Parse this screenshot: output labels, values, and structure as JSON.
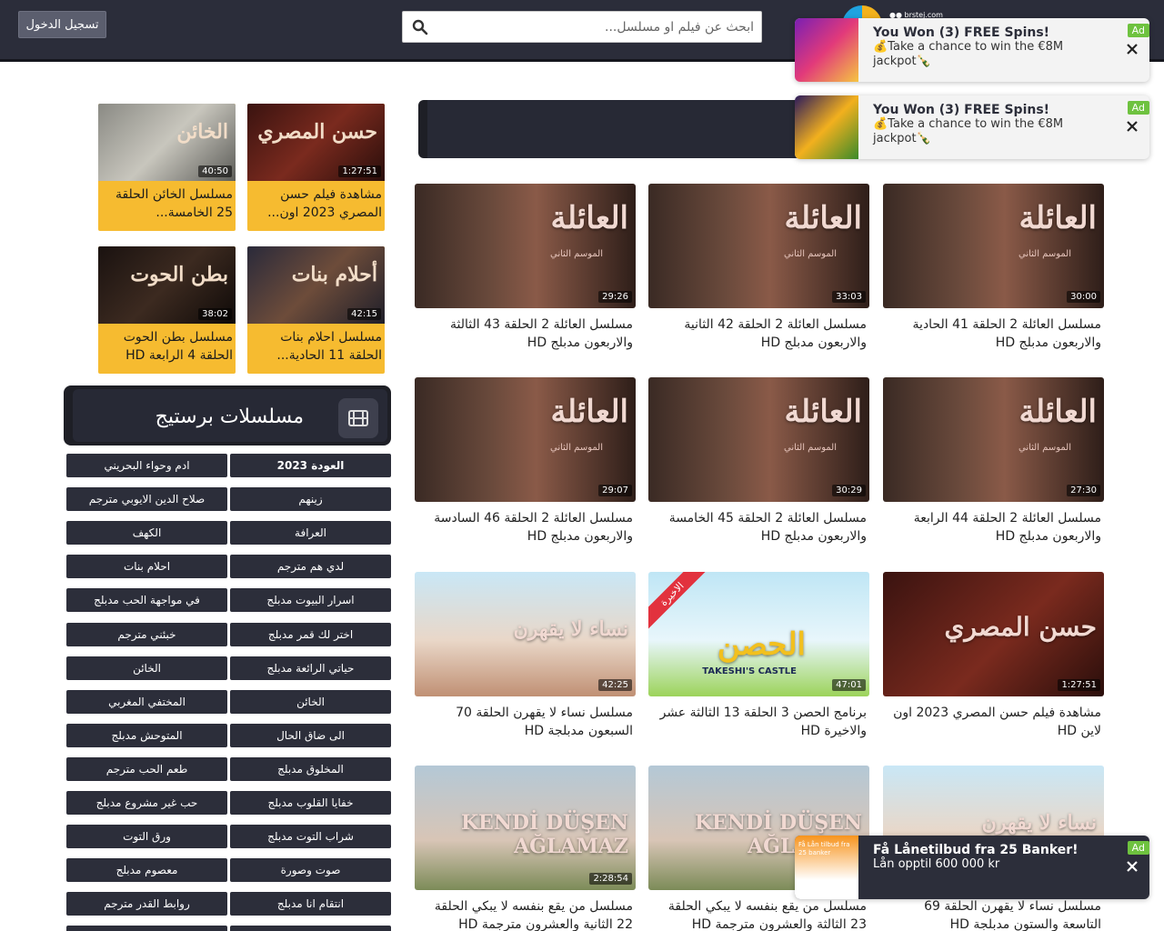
{
  "header": {
    "login_label": "تسجيل الدخول",
    "search_placeholder": "ابحث عن فيلم او مسلسل...",
    "logo_text": "●● brstej.com"
  },
  "grid": [
    {
      "title": "مسلسل العائلة 2 الحلقة 43 الثالثة والاربعون مدبلج HD",
      "duration": "29:26",
      "art": "aile"
    },
    {
      "title": "مسلسل العائلة 2 الحلقة 42 الثانية والاربعون مدبلج HD",
      "duration": "33:03",
      "art": "aile"
    },
    {
      "title": "مسلسل العائلة 2 الحلقة 41 الحادية والاربعون مدبلج HD",
      "duration": "30:00",
      "art": "aile"
    },
    {
      "title": "مسلسل العائلة 2 الحلقة 46 السادسة والاربعون مدبلج HD",
      "duration": "29:07",
      "art": "aile"
    },
    {
      "title": "مسلسل العائلة 2 الحلقة 45 الخامسة والاربعون مدبلج HD",
      "duration": "30:29",
      "art": "aile"
    },
    {
      "title": "مسلسل العائلة 2 الحلقة 44 الرابعة والاربعون مدبلج HD",
      "duration": "27:30",
      "art": "aile"
    },
    {
      "title": "مسلسل نساء لا يقهرن الحلقة 70 السبعون مدبلجة HD",
      "duration": "42:25",
      "art": "nisa"
    },
    {
      "title": "برنامج الحصن 3 الحلقة 13 الثالثة عشر والاخيرة HD",
      "duration": "47:01",
      "art": "castle",
      "ribbon": "الاخيرة"
    },
    {
      "title": "مشاهدة فيلم حسن المصري 2023 اون لاين HD",
      "duration": "1:27:51",
      "art": "hasan"
    },
    {
      "title": "مسلسل من يقع بنفسه لا يبكي الحلقة 22 الثانية والعشرون مترجمة HD",
      "duration": "2:28:54",
      "art": "kendi"
    },
    {
      "title": "مسلسل من يقع بنفسه لا يبكي الحلقة 23 الثالثة والعشرون مترجمة HD",
      "duration": "",
      "art": "kendi"
    },
    {
      "title": "مسلسل نساء لا يقهرن الحلقة 69 التاسعة والستون مدبلجة HD",
      "duration": "",
      "art": "nisa"
    }
  ],
  "art_text": {
    "aile": "العائلة",
    "aile_sub": "الموسم الثاني",
    "nisa": "نساء لا يقهرن",
    "castle": "الحصن",
    "castle_sub": "TAKESHI'S CASTLE",
    "hasan": "حسن المصري",
    "kendi": "KENDİ DÜŞEN AĞLAMAZ"
  },
  "featured": [
    {
      "title": "مشاهدة فيلم حسن المصري 2023 اون...",
      "duration": "1:27:51",
      "art": "حسن المصري"
    },
    {
      "title": "مسلسل الخائن الحلقة 25 الخامسة...",
      "duration": "40:50",
      "art": "الخائن"
    },
    {
      "title": "مسلسل احلام بنات الحلقة 11 الحادية...",
      "duration": "42:15",
      "art": "أحلام بنات"
    },
    {
      "title": "مسلسل بطن الحوت الحلقة 4 الرابعة HD",
      "duration": "38:02",
      "art": "بطن الحوت"
    }
  ],
  "section": {
    "title": "مسلسلات برستيج"
  },
  "tags_right": [
    "العودة 2023",
    "زينهم",
    "العرافة",
    "لدي هم مترجم",
    "اسرار البيوت مدبلج",
    "اختر لك قمر مدبلج",
    "حياتي الرائعة مدبلج",
    "الخائن",
    "الى ضاق الحال",
    "المخلوق مدبلج",
    "خفايا القلوب مدبلج",
    "شراب التوت مدبلج",
    "صوت وصورة",
    "انتقام انا مدبلج"
  ],
  "tags_left": [
    "ادم وحواء البحريني",
    "صلاح الدين الايوبي مترجم",
    "الكهف",
    "احلام بنات",
    "في مواجهة الحب مدبلج",
    "خبئني مترجم",
    "الخائن",
    "المختفي المغربي",
    "المتوحش مدبلج",
    "طعم الحب مترجم",
    "حب غير مشروع مدبلج",
    "ورق التوت",
    "معصوم مدبلج",
    "روابط القدر مترجم"
  ],
  "ads": [
    {
      "title": "You Won (3) FREE Spins!",
      "body": "💰Take a chance to win the €8M jackpot🍾",
      "badge": "Ad"
    },
    {
      "title": "You Won (3) FREE Spins!",
      "body": "💰Take a chance to win the €8M jackpot🍾",
      "badge": "Ad"
    },
    {
      "title": "Få Lånetilbud fra 25 Banker!",
      "body": "Lån opptil 600 000 kr",
      "badge": "Ad",
      "img_text": "Få Lån tilbud fra 25 banker"
    }
  ]
}
